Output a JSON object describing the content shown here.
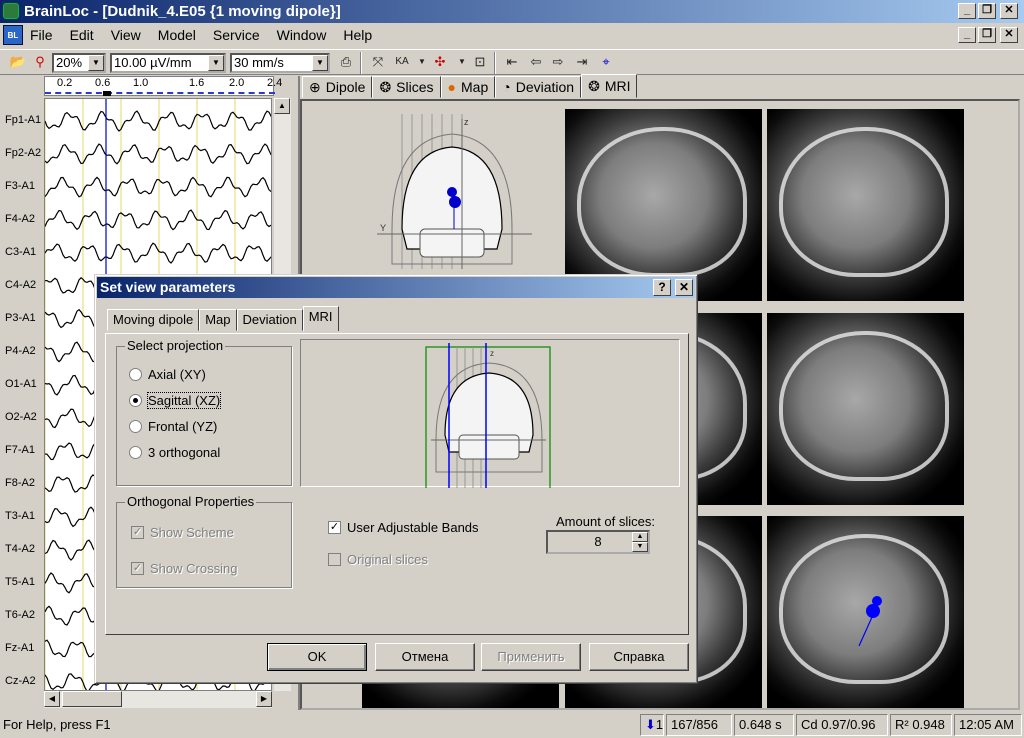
{
  "window": {
    "title": "BrainLoc - [Dudnik_4.E05 {1 moving dipole}]",
    "doc_icon_text": "BL"
  },
  "menu": [
    "File",
    "Edit",
    "View",
    "Model",
    "Service",
    "Window",
    "Help"
  ],
  "toolbar": {
    "zoom": "20%",
    "amplitude": "10.00 µV/mm",
    "speed": "30 mm/s"
  },
  "ruler": {
    "ticks": [
      "0.2",
      "0.6",
      "1.0",
      "1.6",
      "2.0",
      "2.4"
    ]
  },
  "channels": [
    "Fp1-A1",
    "Fp2-A2",
    "F3-A1",
    "F4-A2",
    "C3-A1",
    "C4-A2",
    "P3-A1",
    "P4-A2",
    "O1-A1",
    "O2-A2",
    "F7-A1",
    "F8-A2",
    "T3-A1",
    "T4-A2",
    "T5-A1",
    "T6-A2",
    "Fz-A1",
    "Cz-A2"
  ],
  "view_tabs": [
    "Dipole",
    "Slices",
    "Map",
    "Deviation",
    "MRI"
  ],
  "dialog": {
    "title": "Set view parameters",
    "help_btn": "?",
    "close_btn": "X",
    "tabs": [
      "Moving dipole",
      "Map",
      "Deviation",
      "MRI"
    ],
    "projection": {
      "label": "Select projection",
      "options": [
        "Axial (XY)",
        "Sagittal (XZ)",
        "Frontal (YZ)",
        "3 orthogonal"
      ],
      "selected": "Sagittal (XZ)"
    },
    "orthogonal": {
      "label": "Orthogonal Properties",
      "show_scheme": "Show Scheme",
      "show_crossing": "Show Crossing"
    },
    "user_bands": "User Adjustable Bands",
    "original_slices": "Original slices",
    "amount_label": "Amount of slices:",
    "amount": "8",
    "buttons": {
      "ok": "OK",
      "cancel": "Отмена",
      "apply": "Применить",
      "help": "Справка"
    }
  },
  "status": {
    "help": "For Help, press F1",
    "dipoles": "1",
    "position": "167/856",
    "time": "0.648 s",
    "cd": "Cd 0.97/0.96",
    "r2": "R² 0.948",
    "clock": "12:05 AM"
  },
  "colors": {
    "title_start": "#0a246a",
    "title_end": "#a6caf0",
    "dipole": "#0000c8",
    "face": "#d4d0c8"
  }
}
